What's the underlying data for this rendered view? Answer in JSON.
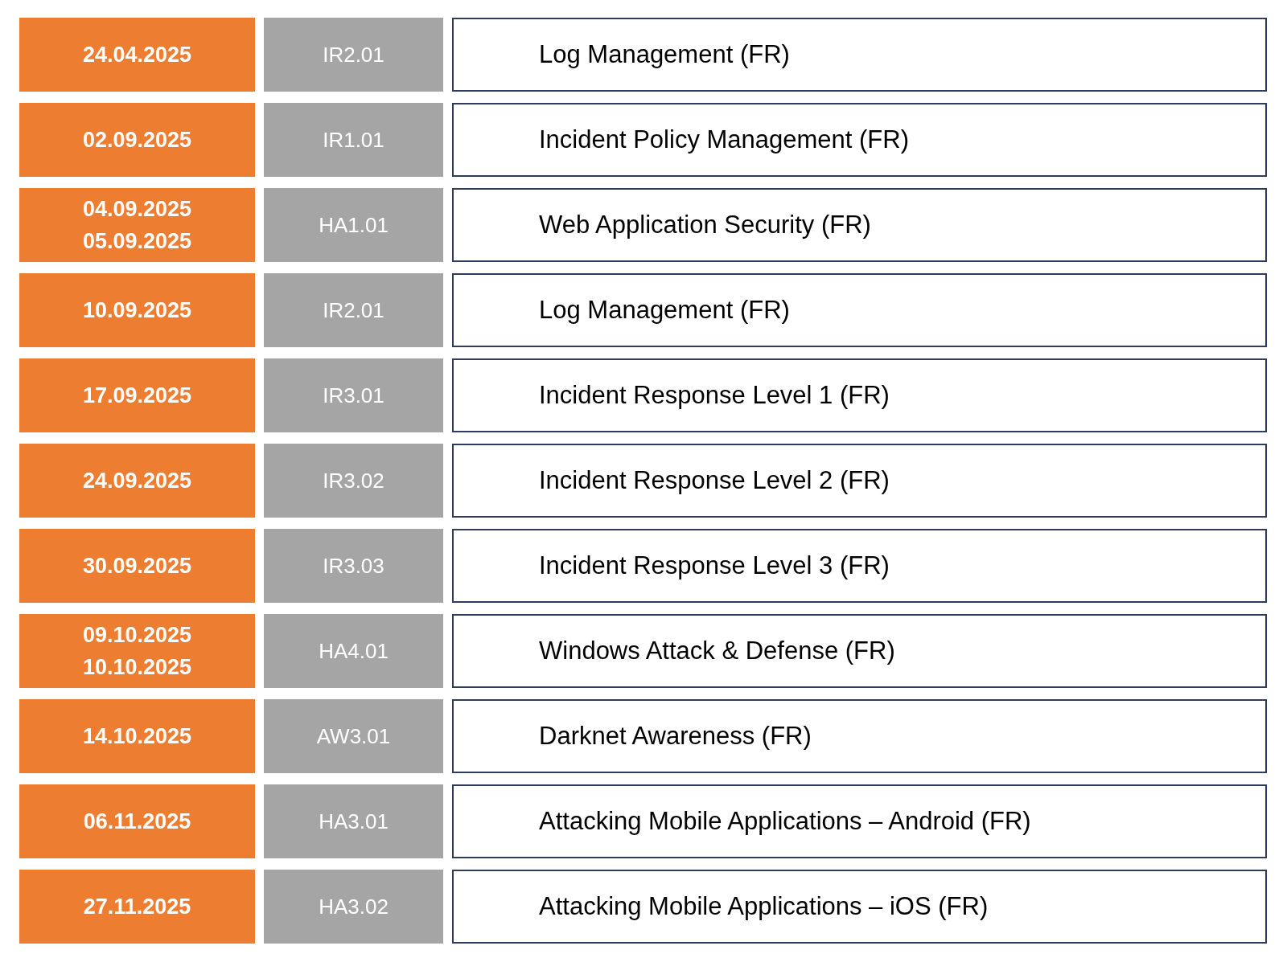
{
  "rows": [
    {
      "dates": [
        "24.04.2025"
      ],
      "code": "IR2.01",
      "title": "Log Management (FR)"
    },
    {
      "dates": [
        "02.09.2025"
      ],
      "code": "IR1.01",
      "title": "Incident Policy Management (FR)"
    },
    {
      "dates": [
        "04.09.2025",
        "05.09.2025"
      ],
      "code": "HA1.01",
      "title": "Web Application Security (FR)"
    },
    {
      "dates": [
        "10.09.2025"
      ],
      "code": "IR2.01",
      "title": "Log Management (FR)"
    },
    {
      "dates": [
        "17.09.2025"
      ],
      "code": "IR3.01",
      "title": "Incident Response Level 1 (FR)"
    },
    {
      "dates": [
        "24.09.2025"
      ],
      "code": "IR3.02",
      "title": "Incident Response Level 2 (FR)"
    },
    {
      "dates": [
        "30.09.2025"
      ],
      "code": "IR3.03",
      "title": "Incident Response Level 3 (FR)"
    },
    {
      "dates": [
        "09.10.2025",
        "10.10.2025"
      ],
      "code": "HA4.01",
      "title": "Windows Attack & Defense (FR)"
    },
    {
      "dates": [
        "14.10.2025"
      ],
      "code": "AW3.01",
      "title": "Darknet Awareness (FR)"
    },
    {
      "dates": [
        "06.11.2025"
      ],
      "code": "HA3.01",
      "title": "Attacking Mobile Applications – Android (FR)"
    },
    {
      "dates": [
        "27.11.2025"
      ],
      "code": "HA3.02",
      "title": "Attacking Mobile Applications – iOS (FR)"
    }
  ]
}
